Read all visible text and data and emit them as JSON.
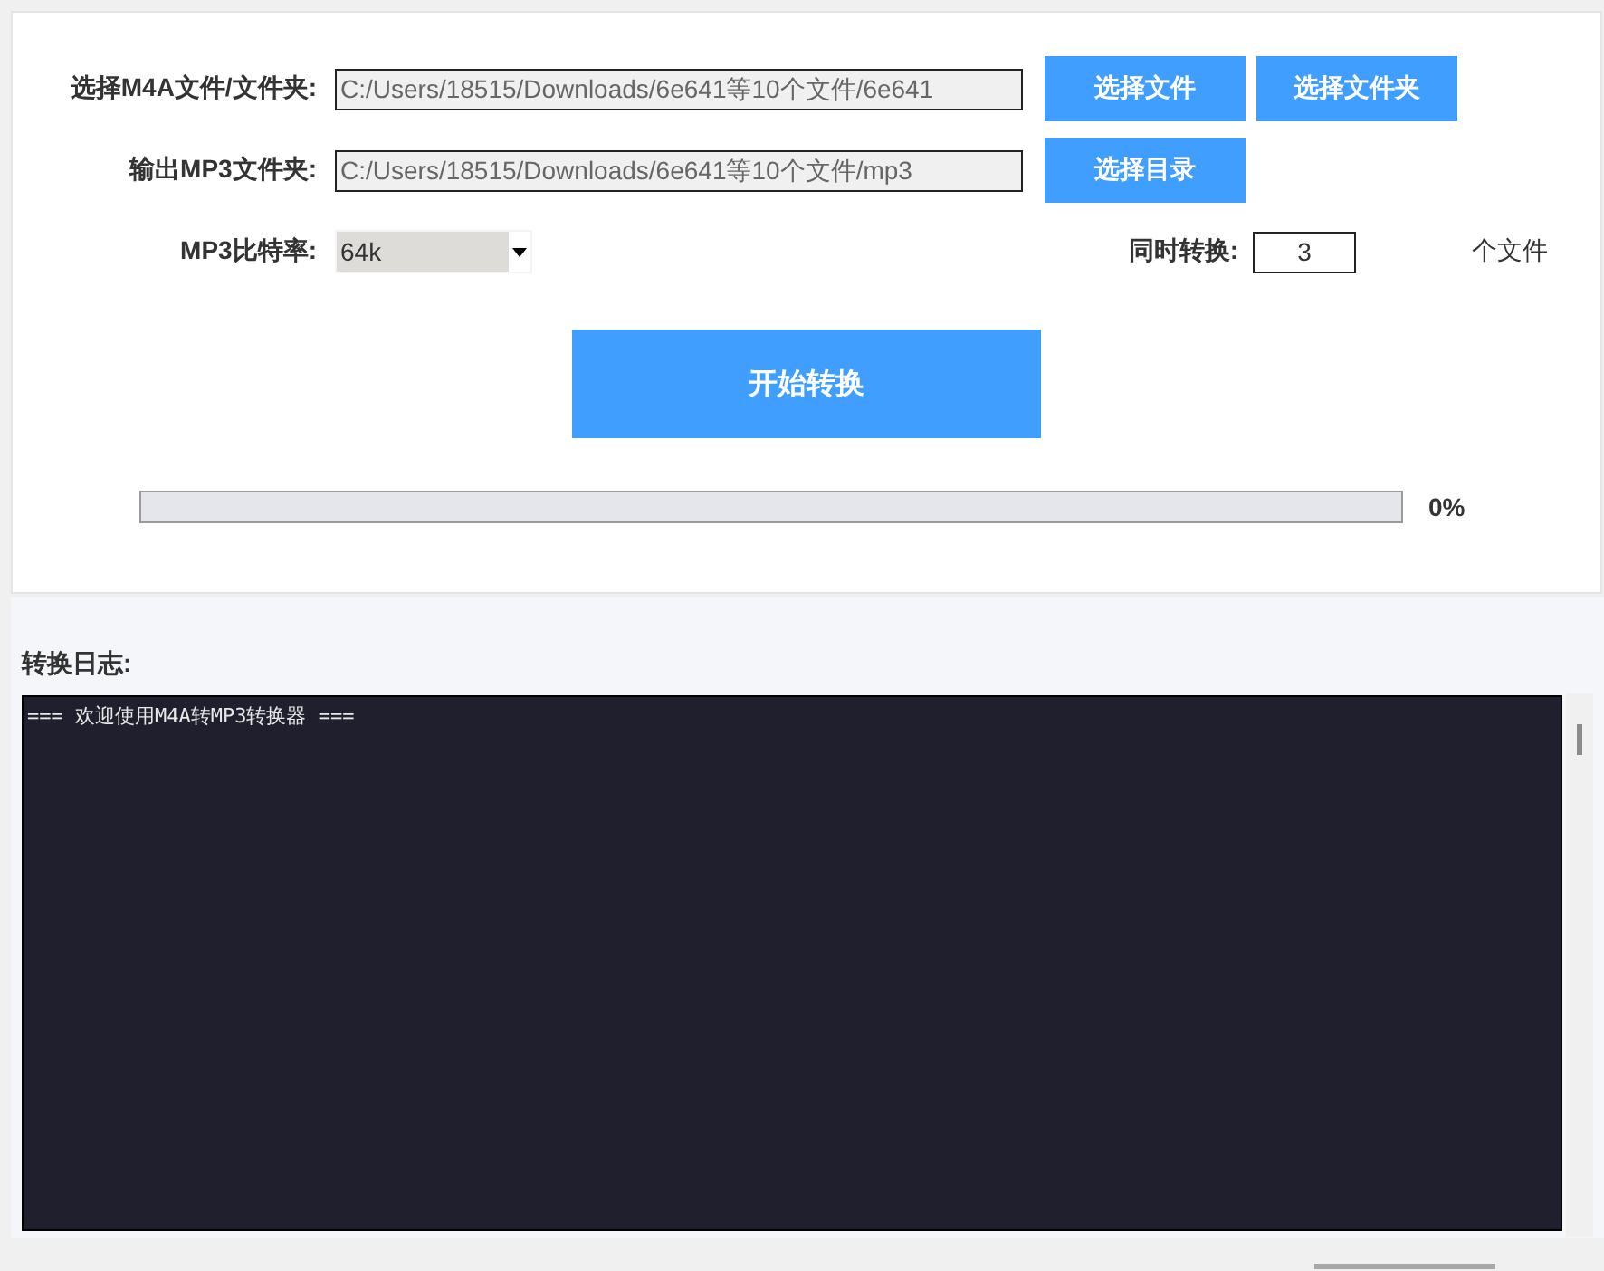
{
  "file_rows": [
    {
      "label": "选择M4A文件/文件夹:",
      "value": "C:/Users/18515/Downloads/6e641等10个文件/6e641",
      "buttons": [
        "选择文件",
        "选择文件夹"
      ]
    },
    {
      "label": "输出MP3文件夹:",
      "value": "C:/Users/18515/Downloads/6e641等10个文件/mp3",
      "buttons": [
        "选择目录"
      ]
    }
  ],
  "bitrate": {
    "label": "MP3比特率:",
    "value": "64k"
  },
  "concurrency": {
    "label": "同时转换:",
    "value": "3",
    "unit": "个文件"
  },
  "start_button": "开始转换",
  "progress": {
    "level": 0,
    "reading": "0%"
  },
  "log": {
    "title": "转换日志:",
    "lines": [
      "=== 欢迎使用M4A转MP3转换器 ==="
    ]
  }
}
